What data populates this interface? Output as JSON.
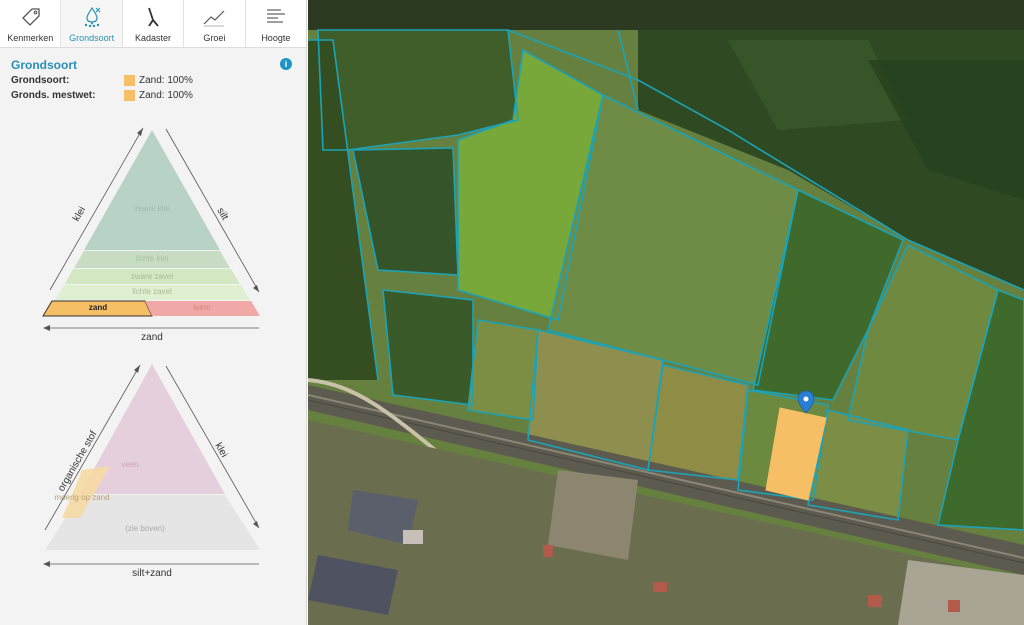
{
  "tabs": [
    {
      "label": "Kenmerken",
      "icon": "tag-icon",
      "active": false
    },
    {
      "label": "Grondsoort",
      "icon": "soil-drop-icon",
      "active": true
    },
    {
      "label": "Kadaster",
      "icon": "kadaster-icon",
      "active": false
    },
    {
      "label": "Groei",
      "icon": "growth-chart-icon",
      "active": false
    },
    {
      "label": "Hoogte",
      "icon": "height-lines-icon",
      "active": false
    }
  ],
  "panel": {
    "title": "Grondsoort",
    "info_icon": "i",
    "properties": [
      {
        "label": "Grondsoort:",
        "value": "Zand: 100%",
        "color": "#f7bf65"
      },
      {
        "label": "Gronds. mestwet:",
        "value": "Zand: 100%",
        "color": "#f7bf65"
      }
    ]
  },
  "triangle1": {
    "left_axis": "klei",
    "right_axis": "silt",
    "bottom_axis": "zand",
    "bands": {
      "zware_klei": "zware klei",
      "lichte_klei": "lichte klei",
      "zware_zavel": "zware zavel",
      "lichte_zavel": "lichte zavel",
      "zand": "zand",
      "leem": "leem"
    },
    "colors": {
      "zware_klei": "#b9d2c8",
      "lichte_klei": "#c7dcc2",
      "zware_zavel": "#d3e7c3",
      "lichte_zavel": "#def0cf",
      "zand": "#f7bf65",
      "leem": "#f0a9a6"
    }
  },
  "triangle2": {
    "left_axis": "organische stof",
    "right_axis": "klei",
    "bottom_axis": "silt+zand",
    "bands": {
      "veen": "veen",
      "moerig": "moerig op zand",
      "boven": "(zie boven)"
    },
    "colors": {
      "veen": "#e6cfdc",
      "moerig": "#f6d9a3",
      "boven": "#e5e5e5"
    }
  },
  "map": {
    "marker_icon": "location-pin-icon",
    "selected_parcel_color": "#f7bf65",
    "parcel_border_color": "#1ba3b8"
  }
}
